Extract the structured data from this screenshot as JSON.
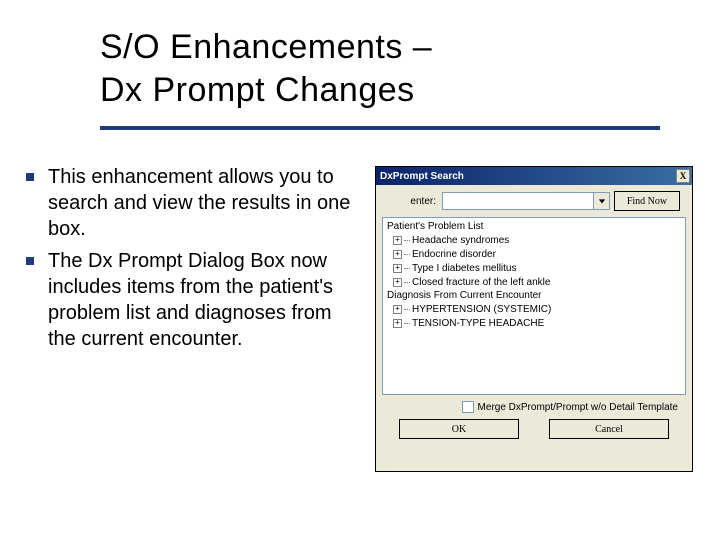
{
  "title": {
    "line1": "S/O Enhancements –",
    "line2": "Dx Prompt Changes"
  },
  "bullets": [
    "This enhancement allows you to search and view the results in one box.",
    "The Dx Prompt Dialog Box now includes items from the patient's problem list and diagnoses from the current encounter."
  ],
  "dialog": {
    "title": "DxPrompt Search",
    "close_x": "X",
    "search_label": "enter:",
    "find_now": "Find Now",
    "list": {
      "group1_label": "Patient's Problem List",
      "group1_items": [
        "Headache syndromes",
        "Endocrine disorder",
        "Type I diabetes mellitus",
        "Closed fracture of the left ankle"
      ],
      "group2_label": "Diagnosis From Current Encounter",
      "group2_items": [
        "HYPERTENSION (SYSTEMIC)",
        "TENSION-TYPE HEADACHE"
      ]
    },
    "merge_label": "Merge DxPrompt/Prompt w/o Detail Template",
    "ok": "OK",
    "cancel": "Cancel"
  }
}
